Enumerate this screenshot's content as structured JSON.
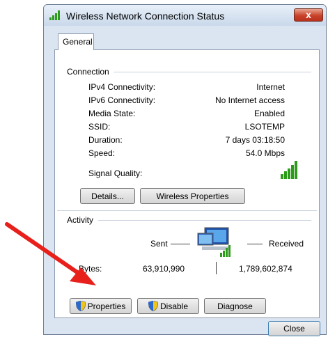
{
  "window": {
    "title": "Wireless Network Connection Status",
    "close_glyph": "x"
  },
  "tabs": [
    {
      "label": "General"
    }
  ],
  "connection": {
    "label": "Connection",
    "rows": [
      {
        "label": "IPv4 Connectivity:",
        "value": "Internet"
      },
      {
        "label": "IPv6 Connectivity:",
        "value": "No Internet access"
      },
      {
        "label": "Media State:",
        "value": "Enabled"
      },
      {
        "label": "SSID:",
        "value": "LSOTEMP"
      },
      {
        "label": "Duration:",
        "value": "7 days 03:18:50"
      },
      {
        "label": "Speed:",
        "value": "54.0 Mbps"
      }
    ],
    "signal_label": "Signal Quality:",
    "signal_icon": "signal-bars-icon",
    "details_button": "Details...",
    "wireless_properties_button": "Wireless Properties"
  },
  "activity": {
    "label": "Activity",
    "sent_label": "Sent",
    "received_label": "Received",
    "bytes_label": "Bytes:",
    "bytes_sent": "63,910,990",
    "bytes_received": "1,789,602,874",
    "network_icon": "network-computers-icon"
  },
  "buttons": {
    "properties": "Properties",
    "disable": "Disable",
    "diagnose": "Diagnose",
    "close": "Close"
  },
  "colors": {
    "annotation_arrow": "#e8201c",
    "signal_green": "#2e9a1c",
    "title_close_red": "#c8432b"
  }
}
